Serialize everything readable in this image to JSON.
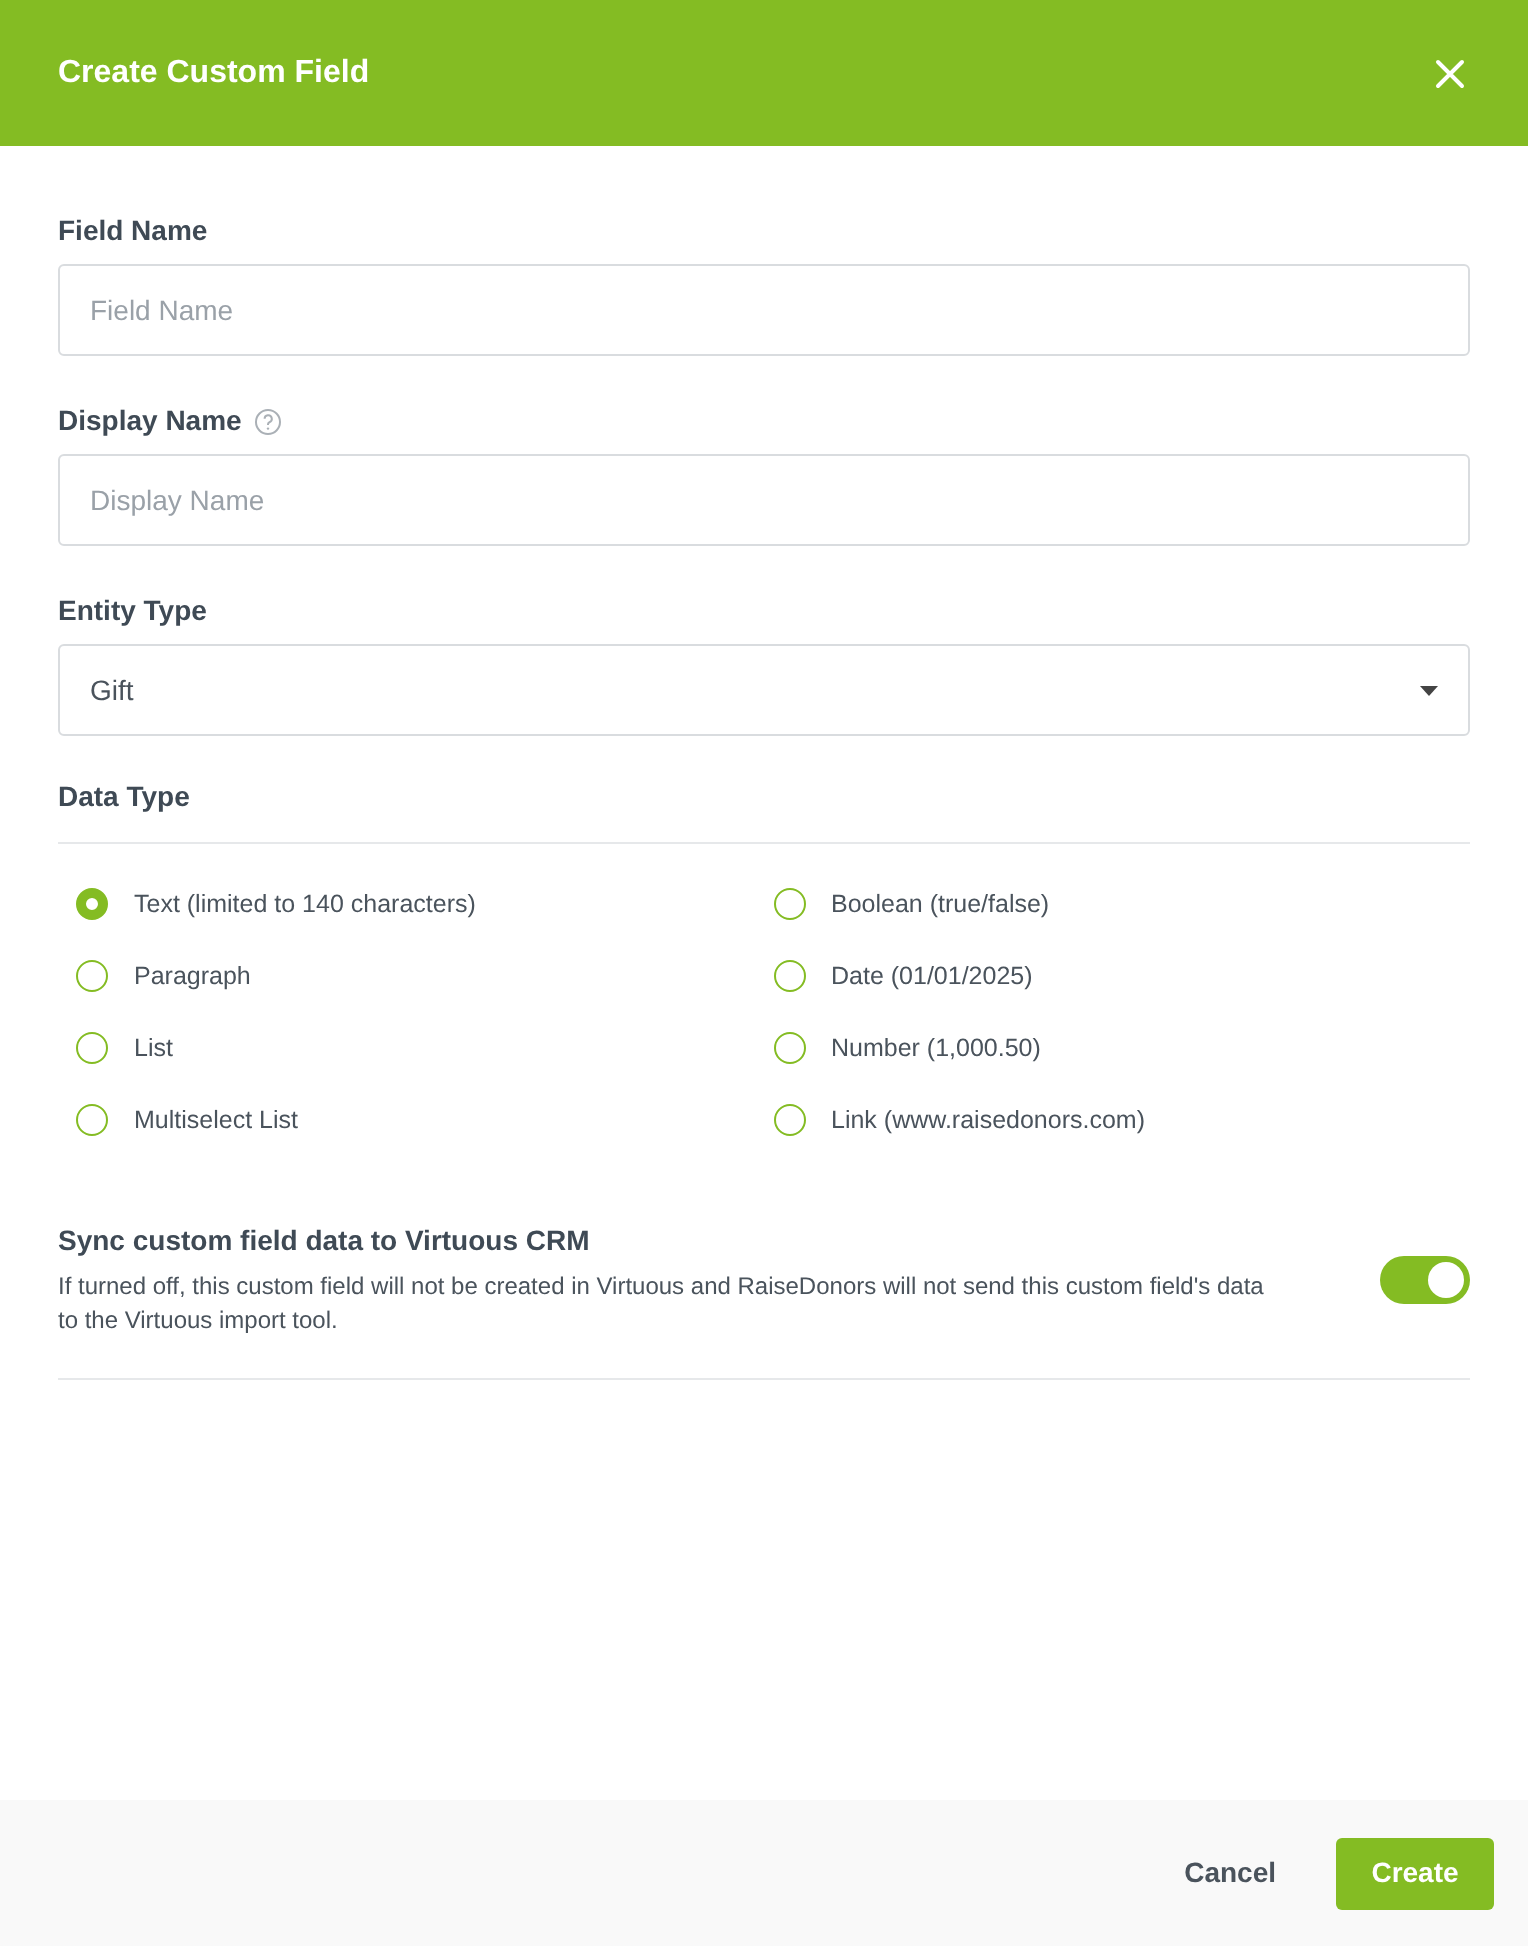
{
  "header": {
    "title": "Create Custom Field"
  },
  "fields": [
    {
      "kind": "input",
      "label": "Field Name",
      "help": false,
      "placeholder": "Field Name"
    },
    {
      "kind": "input",
      "label": "Display Name",
      "help": true,
      "placeholder": "Display Name"
    },
    {
      "kind": "select",
      "label": "Entity Type",
      "help": false,
      "value": "Gift"
    }
  ],
  "data_type": {
    "label": "Data Type",
    "options": [
      {
        "label": "Text (limited to 140 characters)",
        "selected": true
      },
      {
        "label": "Boolean (true/false)",
        "selected": false
      },
      {
        "label": "Paragraph",
        "selected": false
      },
      {
        "label": "Date (01/01/2025)",
        "selected": false
      },
      {
        "label": "List",
        "selected": false
      },
      {
        "label": "Number (1,000.50)",
        "selected": false
      },
      {
        "label": "Multiselect List",
        "selected": false
      },
      {
        "label": "Link (www.raisedonors.com)",
        "selected": false
      }
    ]
  },
  "sync": {
    "title": "Sync custom field data to Virtuous CRM",
    "description": "If turned off, this custom field will not be created in Virtuous and RaiseDonors will not send this custom field's data to the Virtuous import tool.",
    "on": true
  },
  "buttons": [
    {
      "kind": "secondary",
      "label": "Cancel"
    },
    {
      "kind": "primary",
      "label": "Create"
    }
  ]
}
